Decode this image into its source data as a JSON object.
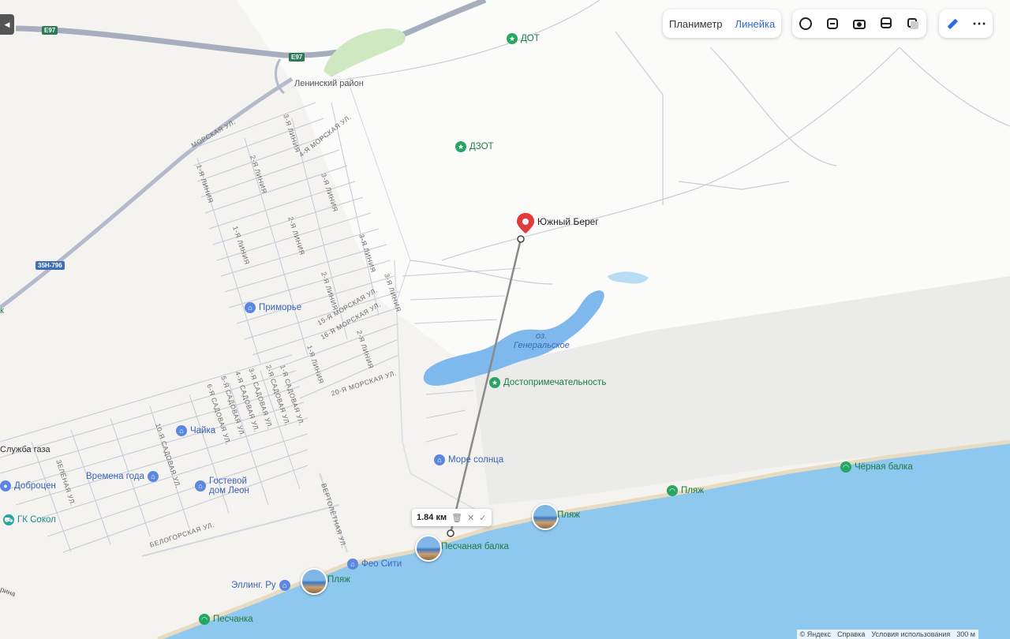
{
  "toolbar": {
    "planimeter_label": "Планиметр",
    "ruler_label": "Линейка",
    "icons": [
      "layers-icon",
      "traffic-icon",
      "panorama-icon",
      "transit-icon",
      "map-type-icon",
      "ruler-icon",
      "more-icon"
    ]
  },
  "places": {
    "leninsky": "Ленинский район",
    "dot": "ДОТ",
    "dzot": "ДЗОТ",
    "yuzhny_bereg": "Южный Берег",
    "primorye": "Приморье",
    "lake_prefix": "оз.",
    "lake_name": "Генеральское",
    "landmark": "Достопримечательность",
    "more_solntsa": "Море солнца",
    "chaika": "Чайка",
    "sluzhba_gaza": "Служба газа",
    "vremena_goda": "Времена года",
    "gostevoy_line1": "Гостевой",
    "gostevoy_line2": "дом Леон",
    "dobrotsen": "Доброцен",
    "gk_sokol": "ГК Сокол",
    "feo_siti": "Фео Сити",
    "elling_ru": "Эллинг. Ру",
    "peschanka": "Песчанка",
    "peschanaya_balka": "Песчаная балка",
    "beach": "Пляж",
    "chernaya_balka": "Чёрная балка",
    "rina": "рина",
    "k": "к"
  },
  "roads": {
    "e97": "E97",
    "r35n796": "35Н-796"
  },
  "streets": {
    "morskaya": "Морская ул.",
    "line3a": "3-я линия",
    "morskaya4": "4-я Морская ул.",
    "line2a": "2-я линия",
    "line1a": "1-я линия",
    "line3b": "3-я линия",
    "line2b": "2-я линия",
    "line1b": "1-я линия",
    "line3c": "3-я линия",
    "line3d": "3-я линия",
    "line2c": "2-я линия",
    "morskaya15": "15-я Морская ул.",
    "morskaya16": "16-я Морская ул.",
    "line2d": "2-я линия",
    "line1c": "1-я линия",
    "morskaya20": "20-я Морская ул.",
    "sadovaya1": "1-я Садовая ул.",
    "sadovaya2": "2-я Садовая ул.",
    "sadovaya3": "3-я Садовая ул.",
    "sadovaya4": "4-я Садовая ул.",
    "sadovaya5": "5-я Садовая ул.",
    "sadovaya6": "6-я Садовая ул.",
    "sadovaya10": "10-я Садовая ул.",
    "zelenaya": "Зелёная ул.",
    "belogorskaya": "Белогорская ул.",
    "vertoletnaya": "Вертолётная ул."
  },
  "ruler": {
    "distance": "1.84 км",
    "delete_icon": "trash-icon",
    "close_icon": "close-icon",
    "confirm_icon": "check-icon"
  },
  "footer": {
    "copyright": "© Яндекс",
    "help": "Справка",
    "terms": "Условия использования",
    "scale": "300 м"
  },
  "colors": {
    "sea": "#8ec8ef",
    "land": "#f2f1ee",
    "road": "#aab2c4",
    "beach_green": "#26a563",
    "ruler_link": "#2a6ad9",
    "pin_red": "#e03c3c"
  }
}
